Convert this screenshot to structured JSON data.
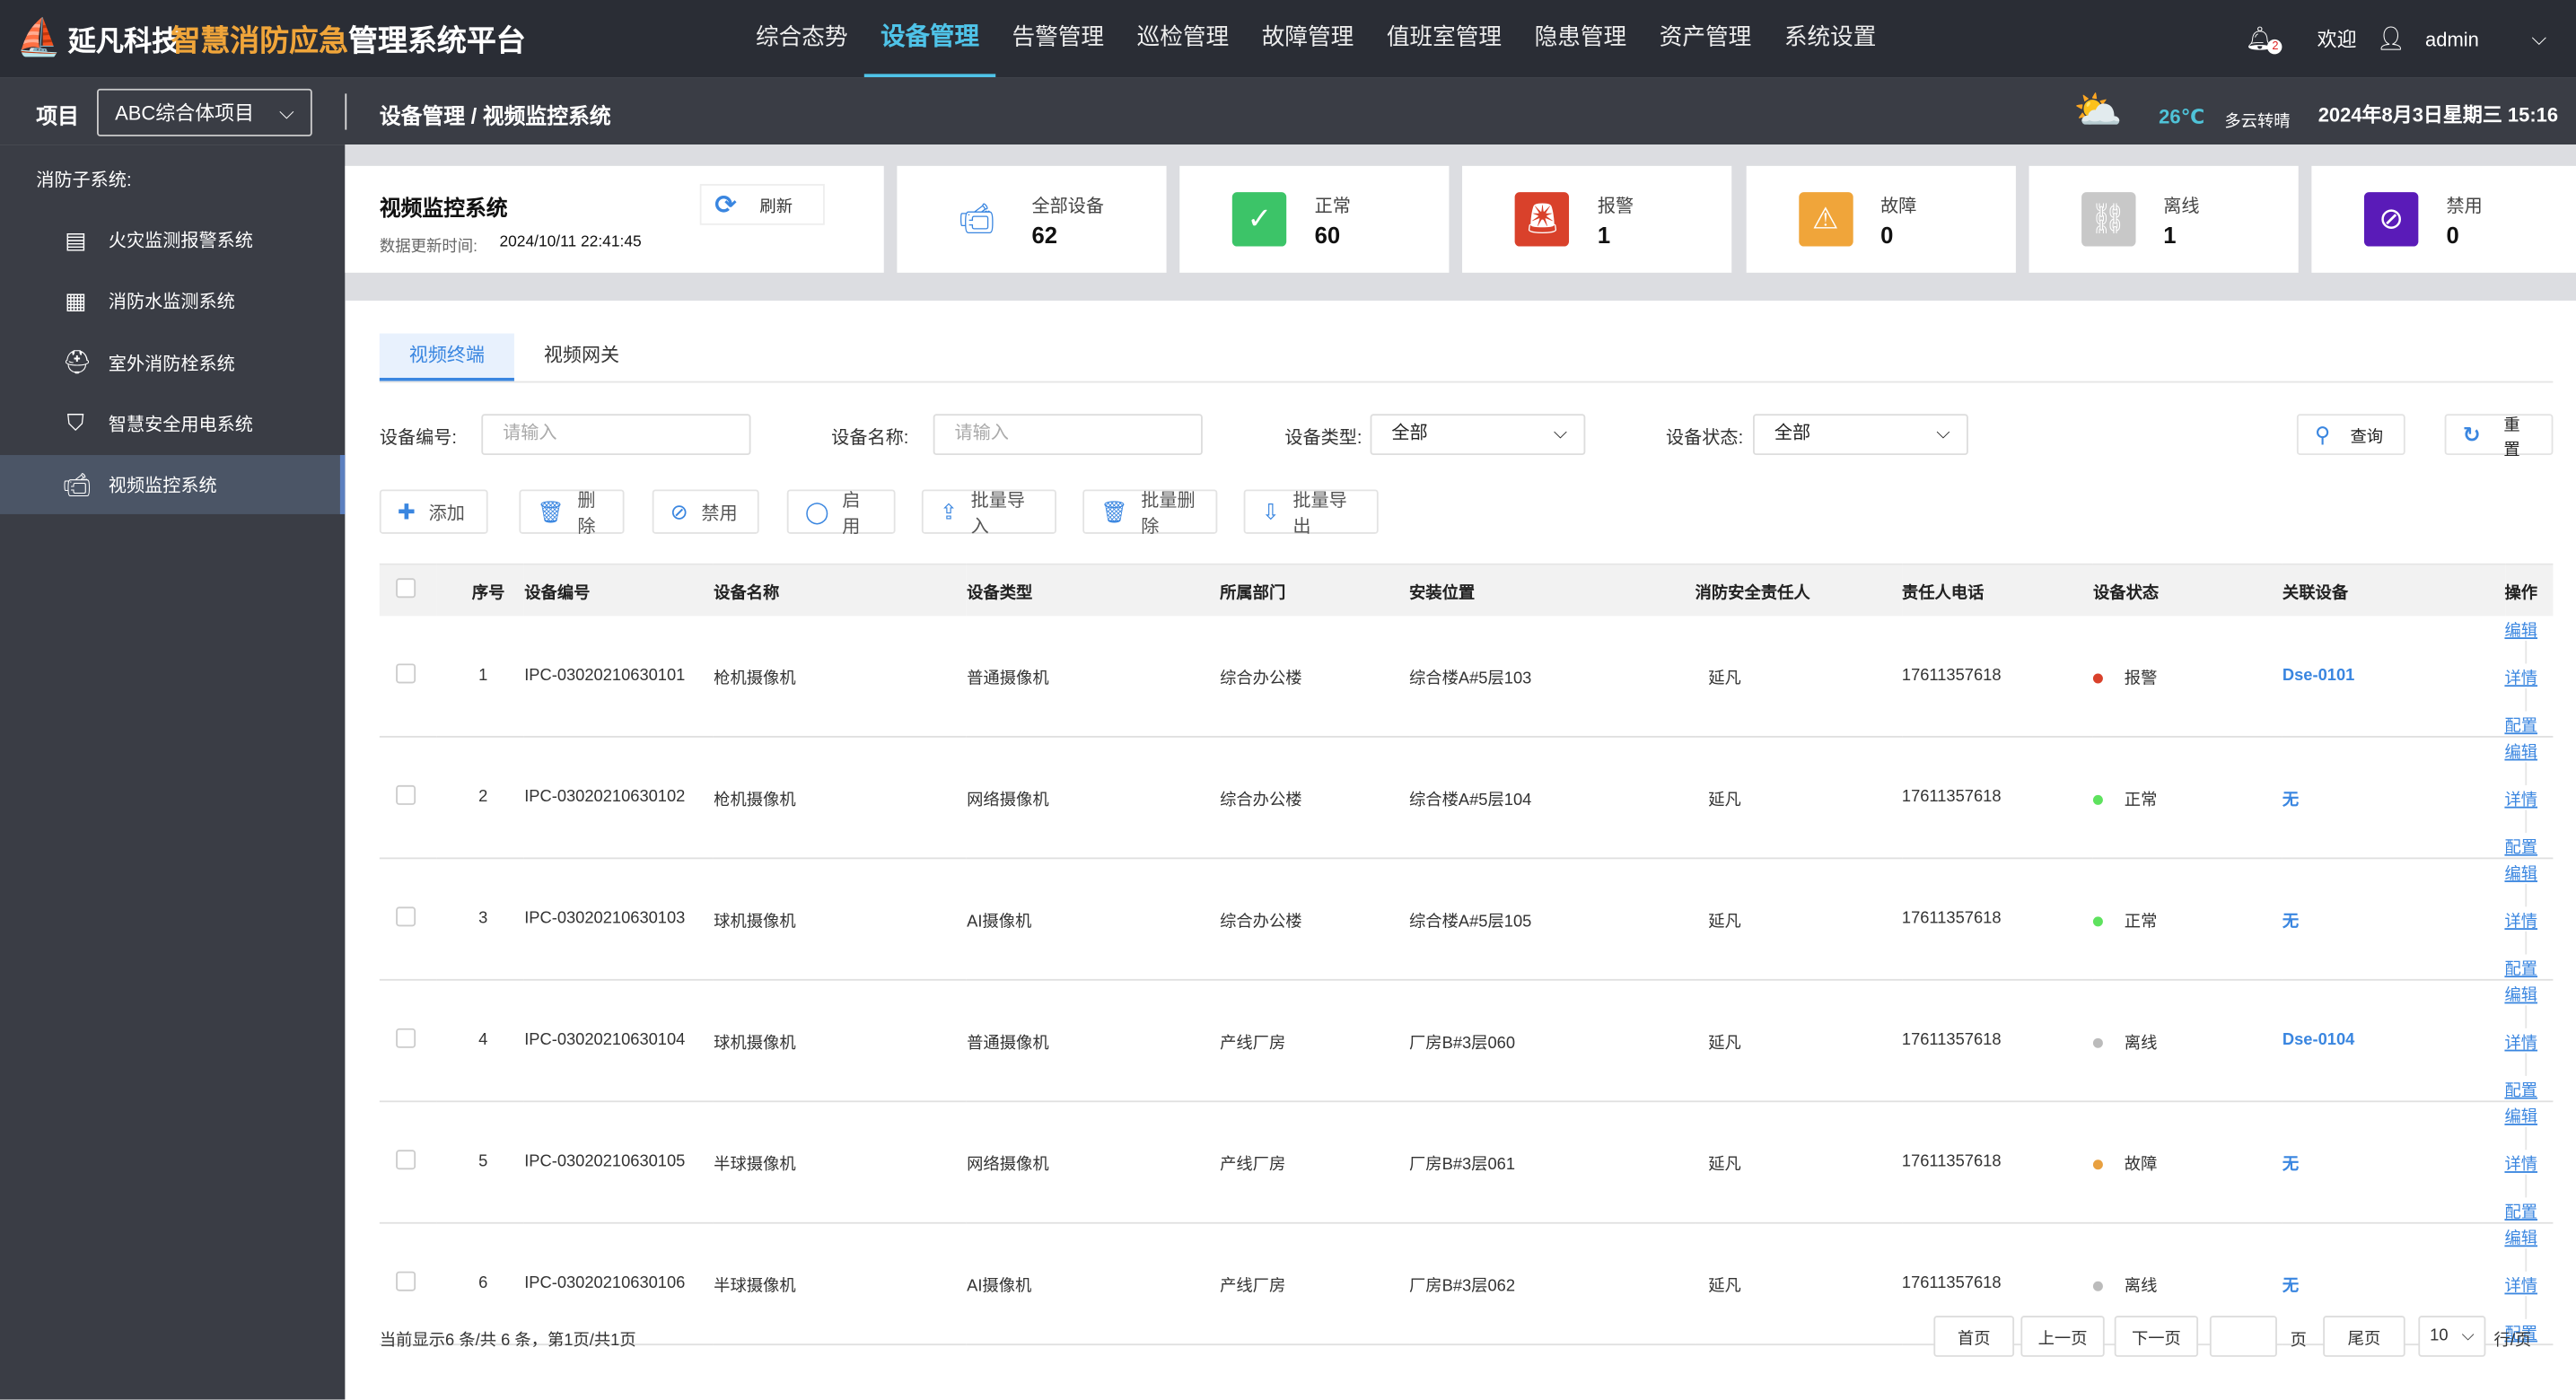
{
  "header": {
    "brand": "延凡科技",
    "title_accent": "智慧消防应急",
    "title_rest": "管理系统平台",
    "nav": [
      "综合态势",
      "设备管理",
      "告警管理",
      "巡检管理",
      "故障管理",
      "值班室管理",
      "隐患管理",
      "资产管理",
      "系统设置"
    ],
    "active_nav": 1,
    "notification_count": "2",
    "welcome": "欢迎",
    "username": "admin"
  },
  "subbar": {
    "project_label": "项目",
    "project_value": "ABC综合体项目",
    "breadcrumb": "设备管理 / 视频监控系统",
    "temperature": "26℃",
    "weather": "多云转晴",
    "datetime": "2024年8月3日星期三 15:16"
  },
  "sidebar": {
    "heading": "消防子系统:",
    "items": [
      {
        "label": "火灾监测报警系统",
        "icon": "fire-alarm-panel-icon"
      },
      {
        "label": "消防水监测系统",
        "icon": "water-meter-icon"
      },
      {
        "label": "室外消防栓系统",
        "icon": "hydrant-icon"
      },
      {
        "label": "智慧安全用电系统",
        "icon": "shield-electric-icon"
      },
      {
        "label": "视频监控系统",
        "icon": "camera-icon"
      }
    ],
    "active": 4
  },
  "summary": {
    "title": "视频监控系统",
    "refresh": "刷新",
    "update_label": "数据更新时间:",
    "update_time": "2024/10/11 22:41:45",
    "cards": [
      {
        "label": "全部设备",
        "value": "62",
        "color": "#3a86e0"
      },
      {
        "label": "正常",
        "value": "60",
        "color": "#3cc468"
      },
      {
        "label": "报警",
        "value": "1",
        "color": "#d9412b"
      },
      {
        "label": "故障",
        "value": "0",
        "color": "#f0a53a"
      },
      {
        "label": "离线",
        "value": "1",
        "color": "#c8c8c8"
      },
      {
        "label": "禁用",
        "value": "0",
        "color": "#5a1bb8"
      }
    ]
  },
  "tabs": [
    "视频终端",
    "视频网关"
  ],
  "filters": {
    "code_label": "设备编号:",
    "code_placeholder": "请输入",
    "name_label": "设备名称:",
    "name_placeholder": "请输入",
    "type_label": "设备类型:",
    "type_value": "全部",
    "status_label": "设备状态:",
    "status_value": "全部",
    "query": "查询",
    "reset": "重置"
  },
  "actions": [
    "添加",
    "删除",
    "禁用",
    "启用",
    "批量导入",
    "批量删除",
    "批量导出"
  ],
  "table": {
    "columns": [
      "序号",
      "设备编号",
      "设备名称",
      "设备类型",
      "所属部门",
      "安装位置",
      "消防安全责任人",
      "责任人电话",
      "设备状态",
      "关联设备",
      "操作"
    ],
    "ops": [
      "编辑",
      "详情",
      "配置"
    ],
    "rows": [
      [
        "1",
        "IPC-03020210630101",
        "枪机摄像机",
        "普通摄像机",
        "综合办公楼",
        "综合楼A#5层103",
        "延凡",
        "17611357618",
        "报警",
        "Dse-0101"
      ],
      [
        "2",
        "IPC-03020210630102",
        "枪机摄像机",
        "网络摄像机",
        "综合办公楼",
        "综合楼A#5层104",
        "延凡",
        "17611357618",
        "正常",
        "无"
      ],
      [
        "3",
        "IPC-03020210630103",
        "球机摄像机",
        "AI摄像机",
        "综合办公楼",
        "综合楼A#5层105",
        "延凡",
        "17611357618",
        "正常",
        "无"
      ],
      [
        "4",
        "IPC-03020210630104",
        "球机摄像机",
        "普通摄像机",
        "产线厂房",
        "厂房B#3层060",
        "延凡",
        "17611357618",
        "离线",
        "Dse-0104"
      ],
      [
        "5",
        "IPC-03020210630105",
        "半球摄像机",
        "网络摄像机",
        "产线厂房",
        "厂房B#3层061",
        "延凡",
        "17611357618",
        "故障",
        "无"
      ],
      [
        "6",
        "IPC-03020210630106",
        "半球摄像机",
        "AI摄像机",
        "产线厂房",
        "厂房B#3层062",
        "延凡",
        "17611357618",
        "离线",
        "无"
      ]
    ],
    "status_colors": {
      "报警": "#d9412b",
      "正常": "#5ee25e",
      "离线": "#bbbbbb",
      "故障": "#e8a040"
    }
  },
  "pagination": {
    "summary": "当前显示6 条/共 6 条，第1页/共1页",
    "first": "首页",
    "prev": "上一页",
    "next": "下一页",
    "page_value": "",
    "page_unit": "页",
    "last": "尾页",
    "page_size": "10",
    "per_page": "行/页"
  }
}
